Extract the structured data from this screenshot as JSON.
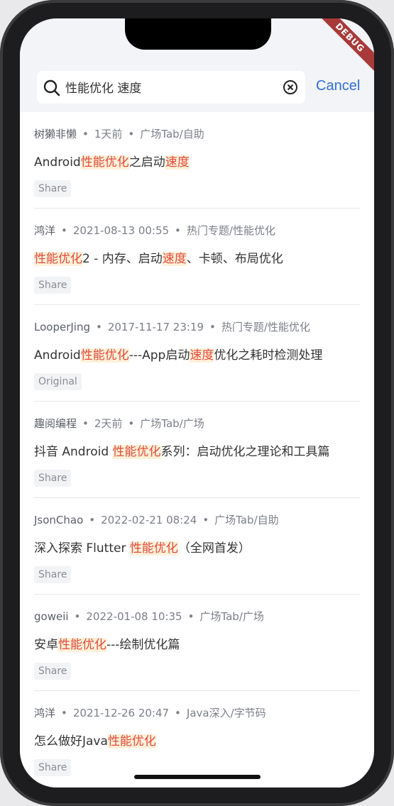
{
  "search": {
    "query": "性能优化 速度",
    "cancel_label": "Cancel"
  },
  "ribbon": {
    "label": "DEBUG"
  },
  "articles": [
    {
      "author": "树獭非懒",
      "time": "1天前",
      "category": "广场Tab/自助",
      "title_parts": [
        {
          "text": "Android",
          "hl": false
        },
        {
          "text": "性能优化",
          "hl": true
        },
        {
          "text": "之启动",
          "hl": false
        },
        {
          "text": "速度",
          "hl": true
        }
      ],
      "tag": "Share"
    },
    {
      "author": "鸿洋",
      "time": "2021-08-13 00:55",
      "category": "热门专题/性能优化",
      "title_parts": [
        {
          "text": "性能优化",
          "hl": true
        },
        {
          "text": "2 - 内存、启动",
          "hl": false
        },
        {
          "text": "速度",
          "hl": true
        },
        {
          "text": "、卡顿、布局优化",
          "hl": false
        }
      ],
      "tag": "Share"
    },
    {
      "author": "LooperJing",
      "time": "2017-11-17 23:19",
      "category": "热门专题/性能优化",
      "title_parts": [
        {
          "text": "Android",
          "hl": false
        },
        {
          "text": "性能优化",
          "hl": true
        },
        {
          "text": "---App启动",
          "hl": false
        },
        {
          "text": "速度",
          "hl": true
        },
        {
          "text": "优化之耗时检测处理",
          "hl": false
        }
      ],
      "tag": "Original"
    },
    {
      "author": "趣阅编程",
      "time": "2天前",
      "category": "广场Tab/广场",
      "title_parts": [
        {
          "text": "抖音 Android ",
          "hl": false
        },
        {
          "text": "性能优化",
          "hl": true
        },
        {
          "text": "系列：启动优化之理论和工具篇",
          "hl": false
        }
      ],
      "tag": "Share"
    },
    {
      "author": "JsonChao",
      "time": "2022-02-21 08:24",
      "category": "广场Tab/自助",
      "title_parts": [
        {
          "text": "深入探索 Flutter ",
          "hl": false
        },
        {
          "text": "性能优化",
          "hl": true
        },
        {
          "text": "（全网首发）",
          "hl": false
        }
      ],
      "tag": "Share"
    },
    {
      "author": "goweii",
      "time": "2022-01-08 10:35",
      "category": "广场Tab/广场",
      "title_parts": [
        {
          "text": "安卓",
          "hl": false
        },
        {
          "text": "性能优化",
          "hl": true
        },
        {
          "text": "---绘制优化篇",
          "hl": false
        }
      ],
      "tag": "Share"
    },
    {
      "author": "鸿洋",
      "time": "2021-12-26 20:47",
      "category": "Java深入/字节码",
      "title_parts": [
        {
          "text": "怎么做好Java",
          "hl": false
        },
        {
          "text": "性能优化",
          "hl": true
        }
      ],
      "tag": "Share"
    }
  ]
}
